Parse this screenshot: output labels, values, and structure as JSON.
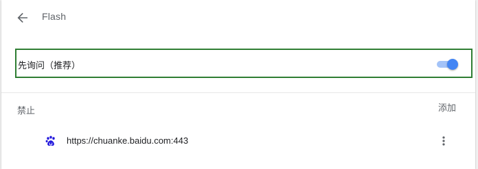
{
  "header": {
    "title": "Flash",
    "back_icon": "arrow-left-icon"
  },
  "ask_setting": {
    "label": "先询问（推荐）",
    "toggle_on": true,
    "toggle_color": "#4285f4",
    "toggle_track_color": "#a3c3f8"
  },
  "blocked_section": {
    "title": "禁止",
    "add_label": "添加",
    "sites": [
      {
        "url": "https://chuanke.baidu.com:443",
        "icon": "baidu-paw-icon",
        "more_icon": "more-vert-icon"
      }
    ]
  },
  "colors": {
    "highlight_border": "#2e7d32",
    "baidu_blue": "#2319dc"
  }
}
